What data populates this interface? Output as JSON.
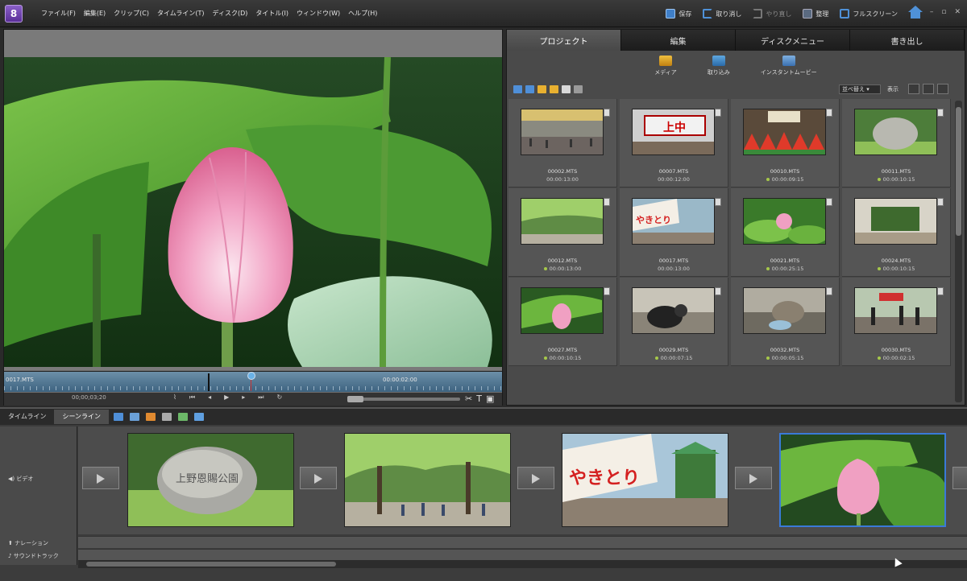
{
  "menubar": {
    "logo": "8",
    "items": [
      "ファイル(F)",
      "編集(E)",
      "クリップ(C)",
      "タイムライン(T)",
      "ディスク(D)",
      "タイトル(I)",
      "ウィンドウ(W)",
      "ヘルプ(H)"
    ],
    "actions": {
      "save": "保存",
      "undo": "取り消し",
      "redo": "やり直し",
      "organize": "整理",
      "fullscreen": "フルスクリーン"
    }
  },
  "preview": {
    "scrub_left_label": "0017.MTS",
    "scrub_right_label": "00:00:02:00",
    "timecode": "00;00;03;20"
  },
  "project": {
    "tabs": [
      "プロジェクト",
      "編集",
      "ディスクメニュー",
      "書き出し"
    ],
    "media_tools": [
      "メディア",
      "取り込み",
      "インスタントムービー"
    ],
    "sort": "並べ替え ▾",
    "show": "表示",
    "clips": [
      {
        "name": "00002.MTS",
        "dur": "00:00:13:00",
        "dot": false,
        "scene": "mall"
      },
      {
        "name": "00007.MTS",
        "dur": "00:00:12:00",
        "dot": false,
        "scene": "gate"
      },
      {
        "name": "00010.MTS",
        "dur": "00:00:09:15",
        "dot": true,
        "scene": "fruit"
      },
      {
        "name": "00011.MTS",
        "dur": "00:00:10:15",
        "dot": true,
        "scene": "stone"
      },
      {
        "name": "00012.MTS",
        "dur": "00:00:13:00",
        "dot": true,
        "scene": "park"
      },
      {
        "name": "00017.MTS",
        "dur": "00:00:13:00",
        "dot": false,
        "scene": "stall"
      },
      {
        "name": "00021.MTS",
        "dur": "00:00:25:15",
        "dot": true,
        "scene": "lotus"
      },
      {
        "name": "00024.MTS",
        "dur": "00:00:10:15",
        "dot": true,
        "scene": "garden"
      },
      {
        "name": "00027.MTS",
        "dur": "00:00:10:15",
        "dot": true,
        "scene": "bud"
      },
      {
        "name": "00029.MTS",
        "dur": "00:00:07:15",
        "dot": true,
        "scene": "cat"
      },
      {
        "name": "00032.MTS",
        "dur": "00:00:05:15",
        "dot": true,
        "scene": "cat2"
      },
      {
        "name": "00030.MTS",
        "dur": "00:00:02:15",
        "dot": true,
        "scene": "street"
      }
    ]
  },
  "timeline": {
    "tabs": [
      "タイムライン",
      "シーンライン"
    ],
    "tracks": {
      "video": "◀) ビデオ",
      "narration": "⬆ ナレーション",
      "soundtrack": "♪ サウンドトラック"
    }
  },
  "colors": {
    "accent": "#4f91d8",
    "selected_border": "#3a7ad8",
    "scrub_bar": "#4d7592"
  }
}
